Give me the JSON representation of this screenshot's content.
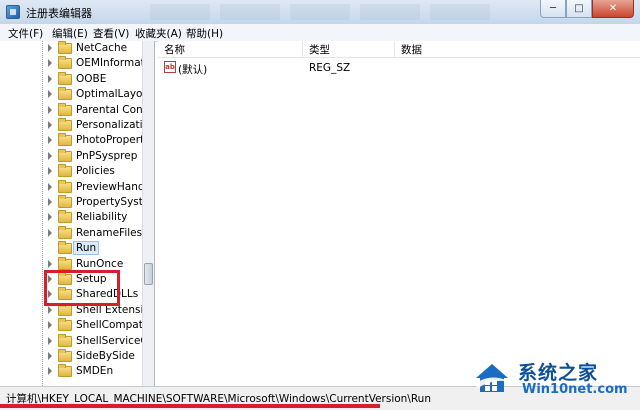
{
  "window": {
    "title": "注册表编辑器",
    "minimize_glyph": "─",
    "maximize_glyph": "□",
    "close_glyph": "✕"
  },
  "menu": [
    "文件(F)",
    "编辑(E)",
    "查看(V)",
    "收藏夹(A)",
    "帮助(H)"
  ],
  "tree": {
    "items": [
      {
        "label": "NetCache"
      },
      {
        "label": "OEMInformatio"
      },
      {
        "label": "OOBE"
      },
      {
        "label": "OptimalLayout"
      },
      {
        "label": "Parental Contr"
      },
      {
        "label": "Personalizatio"
      },
      {
        "label": "PhotoProperty"
      },
      {
        "label": "PnPSysprep"
      },
      {
        "label": "Policies"
      },
      {
        "label": "PreviewHandle"
      },
      {
        "label": "PropertySyster"
      },
      {
        "label": "Reliability"
      },
      {
        "label": "RenameFiles"
      },
      {
        "label": "Run",
        "selected": true
      },
      {
        "label": "RunOnce"
      },
      {
        "label": "Setup"
      },
      {
        "label": "SharedDLLs"
      },
      {
        "label": "Shell Extension"
      },
      {
        "label": "ShellCompatib"
      },
      {
        "label": "ShellServiceOb"
      },
      {
        "label": "SideBySide"
      },
      {
        "label": "SMDEn"
      }
    ]
  },
  "values_pane": {
    "columns": [
      "名称",
      "类型",
      "数据"
    ],
    "rows": [
      {
        "icon": "string-value-icon",
        "icon_text": "ab",
        "name": "(默认)",
        "type": "REG_SZ",
        "data": ""
      }
    ]
  },
  "status": {
    "path": "计算机\\HKEY_LOCAL_MACHINE\\SOFTWARE\\Microsoft\\Windows\\CurrentVersion\\Run"
  },
  "watermark": {
    "cn": "系统之家",
    "en": "Win10net.com"
  },
  "colors": {
    "annotation_red": "#d3202a",
    "selection": "#dceaf8",
    "watermark_blue": "#0b4f97"
  }
}
